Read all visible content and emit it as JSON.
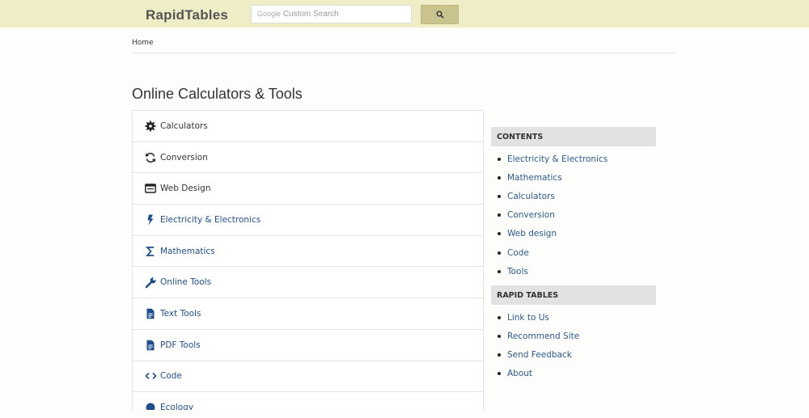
{
  "header": {
    "logo": "RapidTables",
    "search_brand": "Google",
    "search_placeholder": "Custom Search",
    "search_button_icon": "search-icon"
  },
  "breadcrumb": {
    "home": "Home"
  },
  "page": {
    "title": "Online Calculators & Tools"
  },
  "categories": [
    {
      "label": "Calculators",
      "icon": "gear-icon"
    },
    {
      "label": "Conversion",
      "icon": "refresh-icon"
    },
    {
      "label": "Web Design",
      "icon": "browser-window-icon"
    },
    {
      "label": "Electricity & Electronics",
      "icon": "lightning-icon"
    },
    {
      "label": "Mathematics",
      "icon": "sigma-icon"
    },
    {
      "label": "Online Tools",
      "icon": "wrench-icon"
    },
    {
      "label": "Text Tools",
      "icon": "document-icon"
    },
    {
      "label": "PDF Tools",
      "icon": "document-icon"
    },
    {
      "label": "Code",
      "icon": "code-icon"
    },
    {
      "label": "Ecology",
      "icon": "globe-icon"
    }
  ],
  "sidebar": {
    "contents_heading": "CONTENTS",
    "contents": [
      "Electricity & Electronics",
      "Mathematics",
      "Calculators",
      "Conversion",
      "Web design",
      "Code",
      "Tools"
    ],
    "rapid_heading": "RAPID TABLES",
    "rapid": [
      "Link to Us",
      "Recommend Site",
      "Send Feedback",
      "About"
    ]
  },
  "colors": {
    "topbar": "#efedc5",
    "search_button": "#c9c48d",
    "link": "#2b5a91",
    "icon_blue": "#1f4e8c"
  }
}
